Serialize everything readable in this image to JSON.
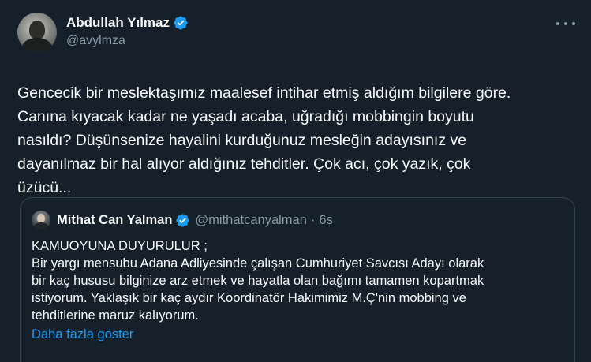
{
  "author": {
    "name": "Abdullah Yılmaz",
    "handle": "@avylmza"
  },
  "tweet": {
    "text": "Gencecik bir meslektaşımız maalesef intihar etmiş aldığım bilgilere göre.\nCanına kıyacak kadar ne yaşadı acaba, uğradığı mobbingin boyutu\nnasıldı? Düşünsenize hayalini kurduğunuz mesleğin adayısınız ve\ndayanılmaz bir hal alıyor aldığınız tehditler. Çok acı, çok yazık, çok\nüzücü..."
  },
  "quote": {
    "name": "Mithat Can Yalman",
    "handle": "@mithatcanyalman",
    "separator": "·",
    "time": "6s",
    "text": "KAMUOYUNA DUYURULUR ;\nBir yargı mensubu Adana Adliyesinde çalışan Cumhuriyet Savcısı Adayı olarak\nbir kaç hususu bilginize arz etmek ve hayatla olan bağımı tamamen kopartmak\nistiyorum. Yaklaşık bir kaç aydır Koordinatör Hakimimiz M.Ç'nin mobbing ve\ntehditlerine maruz kalıyorum.",
    "show_more": "Daha fazla göster"
  },
  "icons": {
    "verified": "verified-badge-icon",
    "more": "more-options-icon"
  },
  "colors": {
    "background": "#15202b",
    "text": "#f7f9f9",
    "secondary": "#8b98a5",
    "accent": "#1d9bf0",
    "border": "#38444d"
  }
}
